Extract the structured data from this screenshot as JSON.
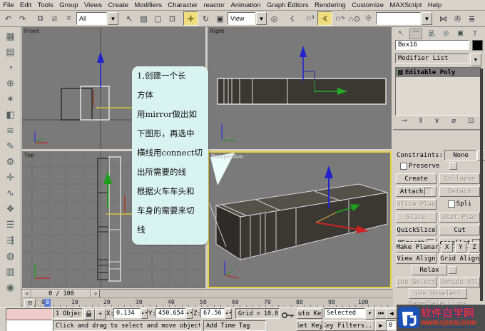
{
  "menu": {
    "items": [
      "File",
      "Edit",
      "Tools",
      "Group",
      "Views",
      "Create",
      "Modifiers",
      "Character",
      "reactor",
      "Animation",
      "Graph Editors",
      "Rendering",
      "Customize",
      "MAXScript",
      "Help"
    ]
  },
  "toolbar": {
    "filter_value": "All",
    "ref_coord_value": "View",
    "named_sets_value": ""
  },
  "viewports": {
    "front": "Front",
    "right": "Right",
    "top": "Top",
    "perspective": "Perspective"
  },
  "bubble": {
    "lines": [
      "1,创建一个长",
      "方体",
      "用mirror做出如",
      "下图形，再选中",
      "横线用connect切",
      "出所需要的线",
      "根据火车车头和",
      "车身的需要来切",
      "线"
    ]
  },
  "panel": {
    "object_name": "Box16",
    "modifier_list": "Modifier List",
    "stack_item": "Editable Poly",
    "edit": {
      "constraints_label": "Constraints:",
      "constraints_value": "None",
      "preserve": "Preserve",
      "create": "Create",
      "collapse": "Collapse",
      "attach": "Attach",
      "detach": "Detach",
      "slice_plane": "Slice Plan",
      "split": "Spli",
      "slice": "Slice",
      "reset_plane": "eset Plan",
      "quickslice": "QuickSlice",
      "cut": "Cut",
      "msmooth": "MSmooth",
      "tessellate": "essellat",
      "make_planar": "Make Planar",
      "x": "X",
      "y": "Y",
      "z": "Z",
      "view_align": "View Align",
      "grid_align": "Grid Align",
      "relax": "Relax",
      "hide_selected": "ide Select",
      "unhide_all": "Unhide All",
      "hide_unselected": "ide Unselect",
      "named_selections": "NamedSelections"
    }
  },
  "timeline": {
    "slider_label": "0 / 100",
    "current_frame_marker": "0",
    "ticks": [
      "0",
      "10",
      "20",
      "30",
      "40",
      "50",
      "60",
      "70",
      "80",
      "90",
      "100"
    ]
  },
  "status": {
    "selection_count": "1 Object",
    "x_label": "X:",
    "x_value": "0.134",
    "y_label": "Y:",
    "y_value": "450.654",
    "z_label": "Z:",
    "z_value": "67.56",
    "grid_value": "Grid = 10.0",
    "prompt": "Click and drag to select and move objects",
    "add_time_tag": "Add Time Tag",
    "auto_key": "Auto Key",
    "set_key": "Set Key",
    "selected_dropdown": "Selected",
    "key_filters": "Key Filters...",
    "frame_value": "0"
  },
  "watermark": {
    "title": "软件自学网",
    "url": "www.rjzxw.com"
  },
  "colors": {
    "active_viewport_border": "#e4d140",
    "bubble_bg": "#d9f3f1",
    "highlight_tool": "#f0dd7e",
    "watermark_red": "#e8372c",
    "watermark_blue": "#1c3f90"
  }
}
